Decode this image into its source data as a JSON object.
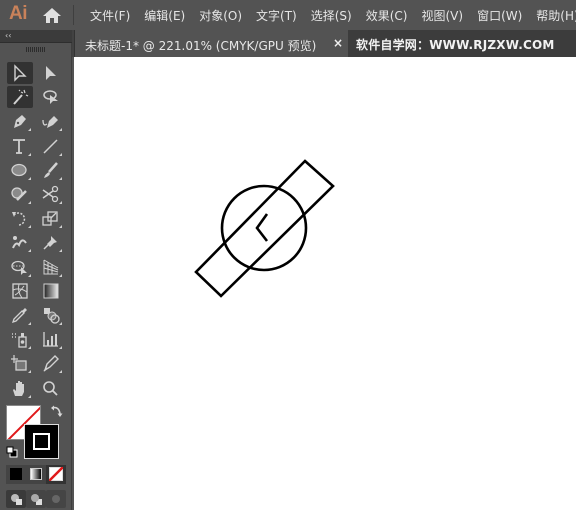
{
  "app": {
    "logo": "Ai",
    "home_icon": "home-icon"
  },
  "menu": [
    {
      "label": "文件(F)"
    },
    {
      "label": "编辑(E)"
    },
    {
      "label": "对象(O)"
    },
    {
      "label": "文字(T)"
    },
    {
      "label": "选择(S)"
    },
    {
      "label": "效果(C)"
    },
    {
      "label": "视图(V)"
    },
    {
      "label": "窗口(W)"
    },
    {
      "label": "帮助(H)"
    }
  ],
  "panel": {
    "collapse_label": "‹‹"
  },
  "document_tab": {
    "title": "未标题-1* @ 221.01% (CMYK/GPU 预览)",
    "close_label": "×"
  },
  "watermark": {
    "text": "软件自学网：WWW.RJZXW.COM"
  },
  "tools": [
    {
      "name": "selection-tool",
      "icon": "arrow-icon",
      "active": true
    },
    {
      "name": "direct-selection-tool",
      "icon": "solid-arrow-icon"
    },
    {
      "name": "magic-wand-tool",
      "icon": "magic-wand-icon",
      "active": true
    },
    {
      "name": "lasso-tool",
      "icon": "lasso-icon"
    },
    {
      "name": "pen-tool",
      "icon": "pen-icon"
    },
    {
      "name": "curvature-tool",
      "icon": "curvature-pen-icon"
    },
    {
      "name": "type-tool",
      "icon": "type-icon"
    },
    {
      "name": "line-segment-tool",
      "icon": "line-icon"
    },
    {
      "name": "ellipse-tool",
      "icon": "ellipse-icon"
    },
    {
      "name": "paintbrush-tool",
      "icon": "brush-icon"
    },
    {
      "name": "shaper-tool",
      "icon": "shaper-icon"
    },
    {
      "name": "scissors-tool",
      "icon": "scissors-icon"
    },
    {
      "name": "rotate-tool",
      "icon": "rotate-icon"
    },
    {
      "name": "scale-tool",
      "icon": "scale-icon"
    },
    {
      "name": "puppet-warp-tool",
      "icon": "puppet-warp-icon"
    },
    {
      "name": "pin-tool",
      "icon": "pin-icon"
    },
    {
      "name": "shape-builder-tool",
      "icon": "shape-builder-icon"
    },
    {
      "name": "perspective-grid-tool",
      "icon": "perspective-grid-icon"
    },
    {
      "name": "mesh-tool",
      "icon": "mesh-icon"
    },
    {
      "name": "gradient-tool",
      "icon": "gradient-icon"
    },
    {
      "name": "eyedropper-tool",
      "icon": "eyedropper-icon"
    },
    {
      "name": "blend-tool",
      "icon": "blend-icon"
    },
    {
      "name": "symbol-sprayer-tool",
      "icon": "symbol-sprayer-icon"
    },
    {
      "name": "column-graph-tool",
      "icon": "bar-graph-icon"
    },
    {
      "name": "artboard-tool",
      "icon": "artboard-icon"
    },
    {
      "name": "slice-tool",
      "icon": "slice-icon"
    },
    {
      "name": "hand-tool",
      "icon": "hand-icon"
    },
    {
      "name": "zoom-tool",
      "icon": "magnifier-icon"
    }
  ],
  "colors": {
    "fill": "none",
    "stroke": "#000000",
    "accent_logo": "#c9825a",
    "none_slash": "#e0191b"
  },
  "artwork": {
    "description": "rotated rectangle over circle with chevron",
    "stroke_color": "#000000"
  }
}
